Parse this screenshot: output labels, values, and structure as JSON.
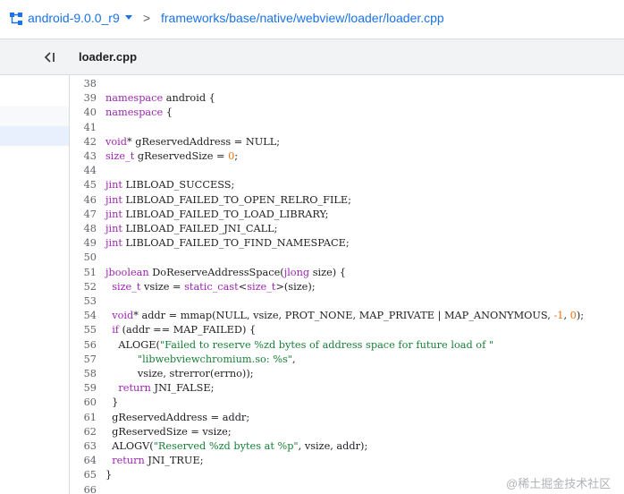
{
  "header": {
    "repo_icon": "repo-icon",
    "branch": "android-9.0.0_r9",
    "separator": ">",
    "path": "frameworks/base/native/webview/loader/loader.cpp"
  },
  "sidebar": {
    "collapse_icon": "collapse-panel-icon"
  },
  "file": {
    "name": "loader.cpp"
  },
  "colors": {
    "link": "#1a73e8",
    "keyword": "#9c27b0",
    "number": "#e8710a",
    "string": "#188038",
    "line_number": "#5f6368"
  },
  "code_lines": [
    {
      "n": "38",
      "code": ""
    },
    {
      "n": "39",
      "code": "namespace android {"
    },
    {
      "n": "40",
      "code": "namespace {"
    },
    {
      "n": "41",
      "code": ""
    },
    {
      "n": "42",
      "code": "void* gReservedAddress = NULL;"
    },
    {
      "n": "43",
      "code": "size_t gReservedSize = 0;"
    },
    {
      "n": "44",
      "code": ""
    },
    {
      "n": "45",
      "code": "jint LIBLOAD_SUCCESS;"
    },
    {
      "n": "46",
      "code": "jint LIBLOAD_FAILED_TO_OPEN_RELRO_FILE;"
    },
    {
      "n": "47",
      "code": "jint LIBLOAD_FAILED_TO_LOAD_LIBRARY;"
    },
    {
      "n": "48",
      "code": "jint LIBLOAD_FAILED_JNI_CALL;"
    },
    {
      "n": "49",
      "code": "jint LIBLOAD_FAILED_TO_FIND_NAMESPACE;"
    },
    {
      "n": "50",
      "code": ""
    },
    {
      "n": "51",
      "code": "jboolean DoReserveAddressSpace(jlong size) {"
    },
    {
      "n": "52",
      "code": "  size_t vsize = static_cast<size_t>(size);"
    },
    {
      "n": "53",
      "code": ""
    },
    {
      "n": "54",
      "code": "  void* addr = mmap(NULL, vsize, PROT_NONE, MAP_PRIVATE | MAP_ANONYMOUS, -1, 0);"
    },
    {
      "n": "55",
      "code": "  if (addr == MAP_FAILED) {"
    },
    {
      "n": "56",
      "code": "    ALOGE(\"Failed to reserve %zd bytes of address space for future load of \""
    },
    {
      "n": "57",
      "code": "          \"libwebviewchromium.so: %s\","
    },
    {
      "n": "58",
      "code": "          vsize, strerror(errno));"
    },
    {
      "n": "59",
      "code": "    return JNI_FALSE;"
    },
    {
      "n": "60",
      "code": "  }"
    },
    {
      "n": "61",
      "code": "  gReservedAddress = addr;"
    },
    {
      "n": "62",
      "code": "  gReservedSize = vsize;"
    },
    {
      "n": "63",
      "code": "  ALOGV(\"Reserved %zd bytes at %p\", vsize, addr);"
    },
    {
      "n": "64",
      "code": "  return JNI_TRUE;"
    },
    {
      "n": "65",
      "code": "}"
    },
    {
      "n": "66",
      "code": ""
    }
  ],
  "watermark": "@稀土掘金技术社区"
}
